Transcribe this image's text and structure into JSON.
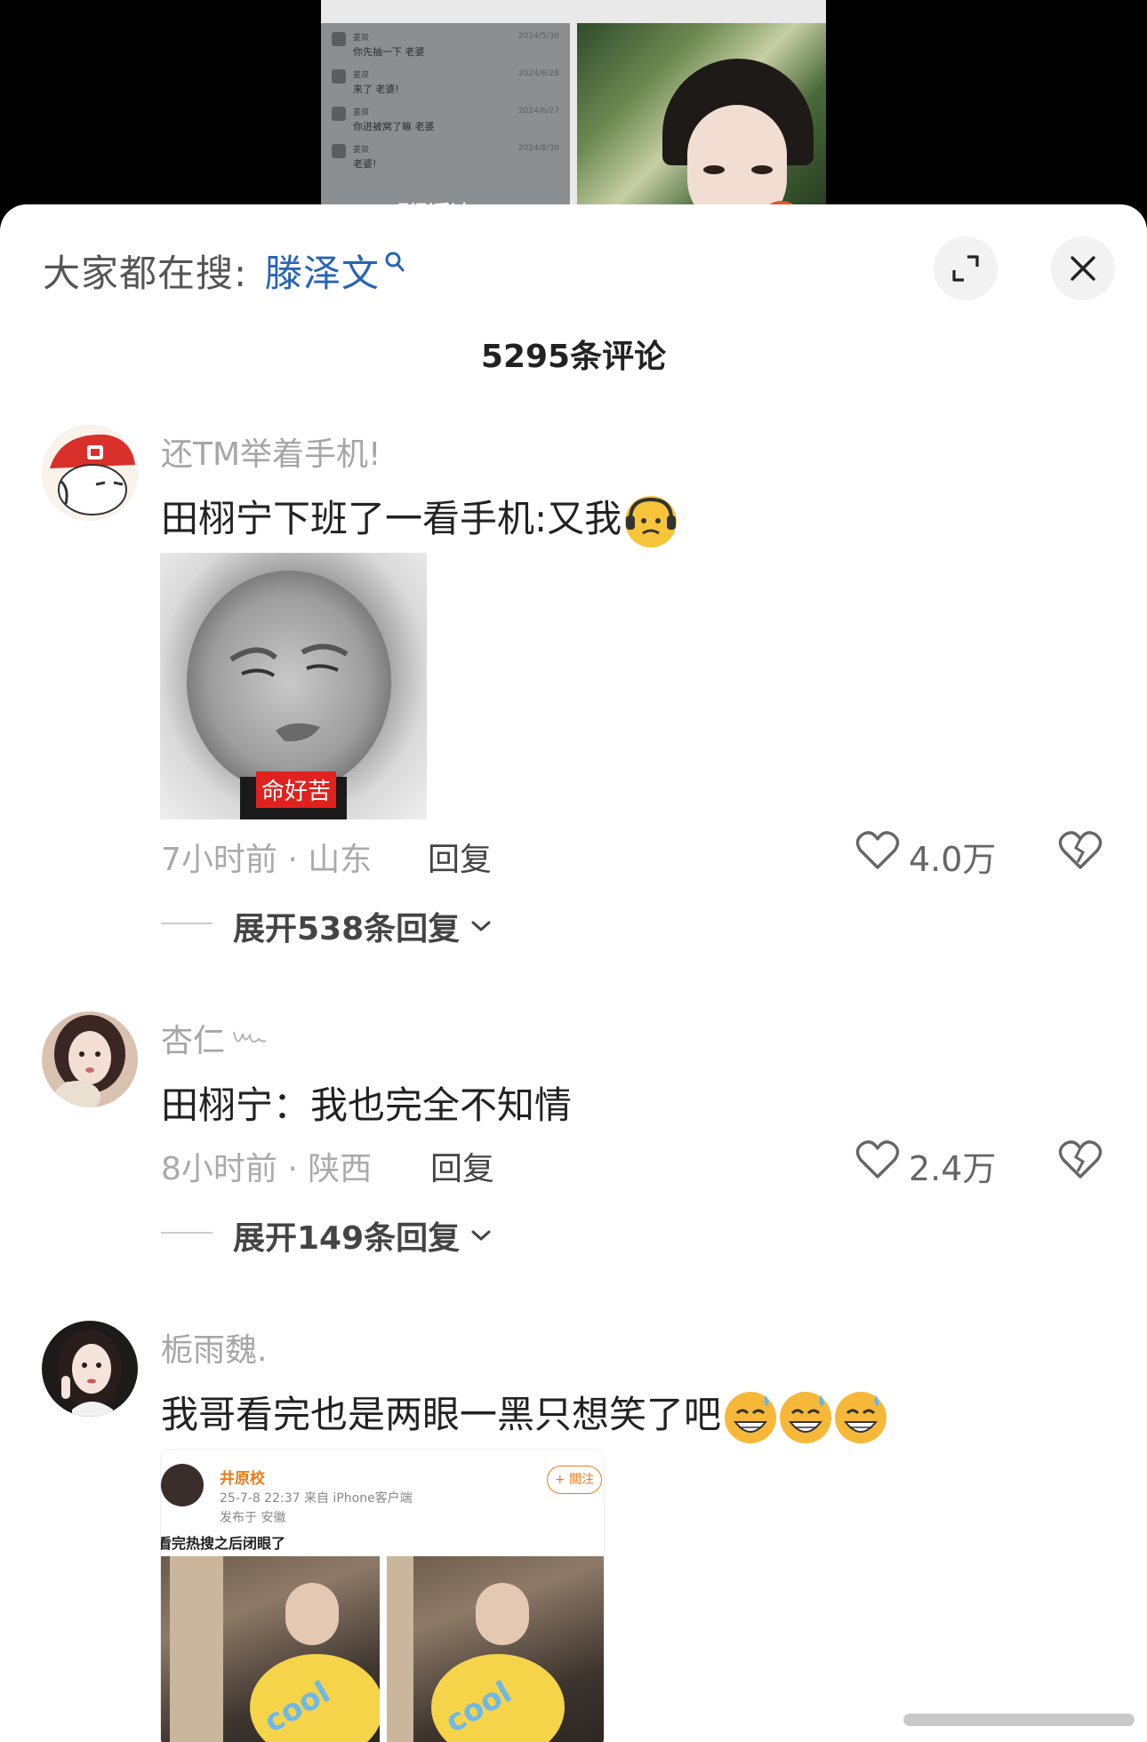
{
  "video": {
    "chat": [
      {
        "name": "姜双",
        "text": "你先抽一下",
        "tag": "老婆",
        "date": "2024/5/30"
      },
      {
        "name": "姜双",
        "text": "来了",
        "tag": "老婆!",
        "date": "2024/6/28"
      },
      {
        "name": "姜双",
        "text": "你进被窝了嘛",
        "tag": "老婆",
        "date": "2024/6/27"
      },
      {
        "name": "姜双",
        "text": "老婆!",
        "tag": "",
        "date": "2024/8/30"
      }
    ],
    "overlay_text": "刚刚看过"
  },
  "header": {
    "search_prompt": "大家都在搜:",
    "search_keyword": "滕泽文",
    "search_icon": "search-icon",
    "expand_icon": "expand-icon",
    "close_icon": "close-icon"
  },
  "comments_title": "5295条评论",
  "comments": [
    {
      "username": "还TM举着手机!",
      "text": "田栩宁下班了一看手机:又我",
      "emoji": "sad-headphones-emoji",
      "image_caption": "命好苦",
      "time_location": "7小时前 · 山东",
      "reply_label": "回复",
      "likes": "4.0万",
      "expand_label": "展开538条回复"
    },
    {
      "username": "杏仁",
      "text": "田栩宁：我也完全不知情",
      "time_location": "8小时前 · 陕西",
      "reply_label": "回复",
      "likes": "2.4万",
      "expand_label": "展开149条回复"
    },
    {
      "username": "栀雨魏.",
      "text": "我哥看完也是两眼一黑只想笑了吧",
      "emoji": "grin-sweat-emoji",
      "weibo": {
        "name": "井原校",
        "meta": "25-7-8 22:37  来自 iPhone客户端",
        "location": "发布于 安徽",
        "follow": "+ 關注",
        "text": "看完热搜之后闭眼了",
        "sticker_text": "cool"
      }
    }
  ],
  "colors": {
    "keyword": "#2864b4",
    "meta": "#aaaaaa",
    "caption_bg": "#e0211d"
  }
}
